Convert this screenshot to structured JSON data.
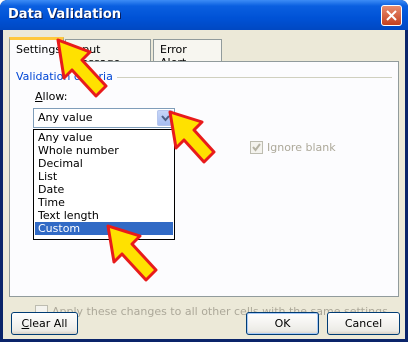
{
  "window": {
    "title": "Data Validation"
  },
  "tabs": [
    {
      "label": "Settings",
      "active": true
    },
    {
      "label": "Input Message",
      "active": false
    },
    {
      "label": "Error Alert",
      "active": false
    }
  ],
  "settings": {
    "group_label": "Validation criteria",
    "allow_label": "Allow:",
    "allow_value": "Any value",
    "allow_options": [
      "Any value",
      "Whole number",
      "Decimal",
      "List",
      "Date",
      "Time",
      "Text length",
      "Custom"
    ],
    "highlighted_option": "Custom",
    "ignore_blank_label": "Ignore blank",
    "apply_label": "Apply these changes to all other cells with the same settings"
  },
  "buttons": {
    "clear_all_label": "Clear All",
    "ok_label": "OK",
    "cancel_label": "Cancel"
  },
  "colors": {
    "annotation_arrow_fill": "#ffe100",
    "annotation_arrow_stroke": "#e81b1b",
    "selection": "#316ac5"
  },
  "icons": {
    "close": "close-icon",
    "dropdown": "chevron-down-icon",
    "annotation": "pointer-arrow-icon"
  }
}
